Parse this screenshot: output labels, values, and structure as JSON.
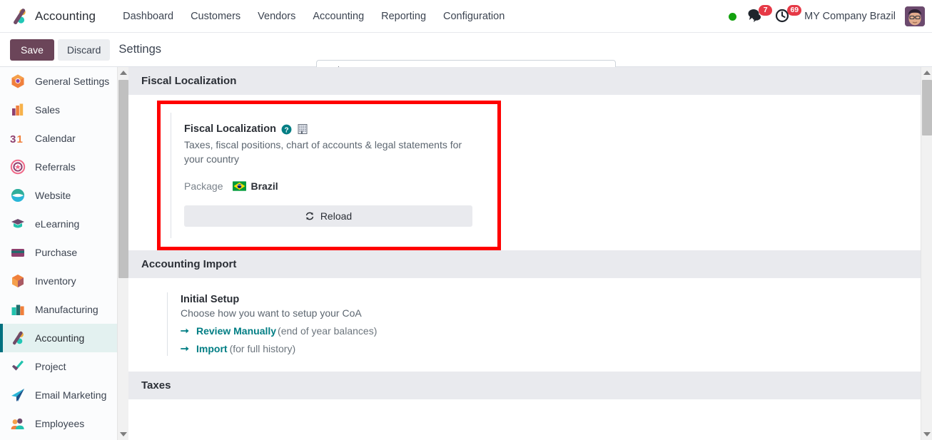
{
  "navbar": {
    "brand": "Accounting",
    "brand_icon": "odoo-accounting-logo",
    "menu": [
      {
        "label": "Dashboard",
        "name": "menu-dashboard"
      },
      {
        "label": "Customers",
        "name": "menu-customers"
      },
      {
        "label": "Vendors",
        "name": "menu-vendors"
      },
      {
        "label": "Accounting",
        "name": "menu-accounting"
      },
      {
        "label": "Reporting",
        "name": "menu-reporting"
      },
      {
        "label": "Configuration",
        "name": "menu-configuration"
      }
    ],
    "status_indicator": {
      "icon": "online-status-dot",
      "color": "#13a10e"
    },
    "messages": {
      "icon": "messages-icon",
      "count": "7",
      "badge_color": "#e63946"
    },
    "activities": {
      "icon": "clock-activities-icon",
      "count": "69",
      "badge_color": "#e63946"
    },
    "company": "MY Company Brazil",
    "avatar": "user-avatar"
  },
  "control_panel": {
    "save_label": "Save",
    "discard_label": "Discard",
    "title": "Settings",
    "search_placeholder": "Search...",
    "search_value": "",
    "search_icon": "search-icon"
  },
  "sidebar": {
    "items": [
      {
        "label": "General Settings",
        "icon": "general-settings-icon",
        "active": false
      },
      {
        "label": "Sales",
        "icon": "sales-icon",
        "active": false
      },
      {
        "label": "Calendar",
        "icon": "calendar-icon",
        "active": false
      },
      {
        "label": "Referrals",
        "icon": "referrals-icon",
        "active": false
      },
      {
        "label": "Website",
        "icon": "website-icon",
        "active": false
      },
      {
        "label": "eLearning",
        "icon": "elearning-icon",
        "active": false
      },
      {
        "label": "Purchase",
        "icon": "purchase-icon",
        "active": false
      },
      {
        "label": "Inventory",
        "icon": "inventory-icon",
        "active": false
      },
      {
        "label": "Manufacturing",
        "icon": "manufacturing-icon",
        "active": false
      },
      {
        "label": "Accounting",
        "icon": "accounting-icon",
        "active": true
      },
      {
        "label": "Project",
        "icon": "project-icon",
        "active": false
      },
      {
        "label": "Email Marketing",
        "icon": "email-marketing-icon",
        "active": false
      },
      {
        "label": "Employees",
        "icon": "employees-icon",
        "active": false
      }
    ]
  },
  "main": {
    "sections": [
      {
        "title": "Fiscal Localization"
      },
      {
        "title": "Accounting Import"
      },
      {
        "title": "Taxes"
      }
    ],
    "fiscal_localization": {
      "title": "Fiscal Localization",
      "help_icon": "help-question-icon",
      "badge_icon": "building-icon",
      "description": "Taxes, fiscal positions, chart of accounts & legal statements for your country",
      "package_label": "Package",
      "package_value": "Brazil",
      "package_flag": "brazil-flag-icon",
      "reload_label": "Reload",
      "reload_icon": "reload-refresh-icon",
      "highlight_color": "#ff0000"
    },
    "accounting_import": {
      "title": "Initial Setup",
      "description": "Choose how you want to setup your CoA",
      "links": [
        {
          "label": "Review Manually",
          "note": "(end of year balances)",
          "icon": "arrow-right-icon"
        },
        {
          "label": "Import",
          "note": "(for full history)",
          "icon": "arrow-right-icon"
        }
      ]
    }
  }
}
